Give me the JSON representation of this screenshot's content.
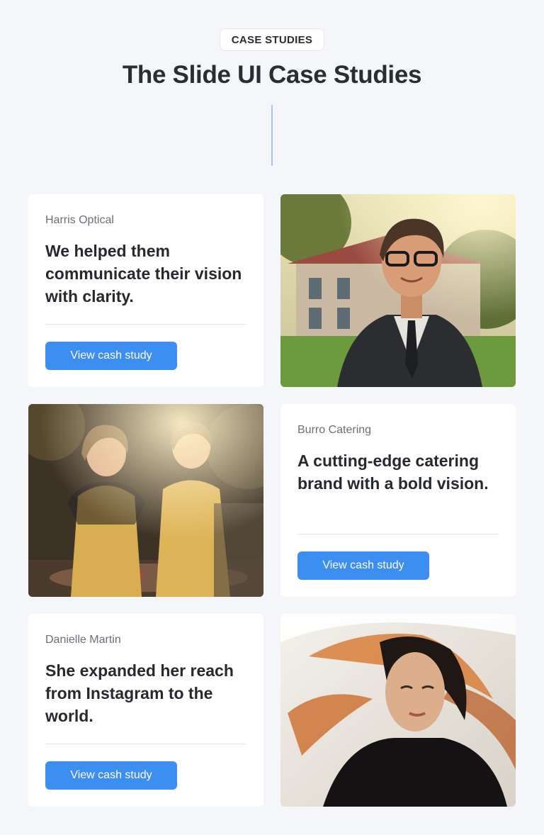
{
  "header": {
    "badge_label": "CASE STUDIES",
    "title": "The Slide UI Case Studies"
  },
  "cases": [
    {
      "company": "Harris Optical",
      "headline": "We helped them communicate their vision with clarity.",
      "button_label": "View cash study"
    },
    {
      "company": "Burro Catering",
      "headline": "A cutting-edge catering brand with a bold vision.",
      "button_label": "View cash study"
    },
    {
      "company": "Danielle Martin",
      "headline": "She expanded her reach from Instagram to the world.",
      "button_label": "View cash study"
    }
  ],
  "colors": {
    "accent": "#3d8ef1",
    "background": "#f5f6f9",
    "card": "#ffffff",
    "text": "#26292d"
  }
}
